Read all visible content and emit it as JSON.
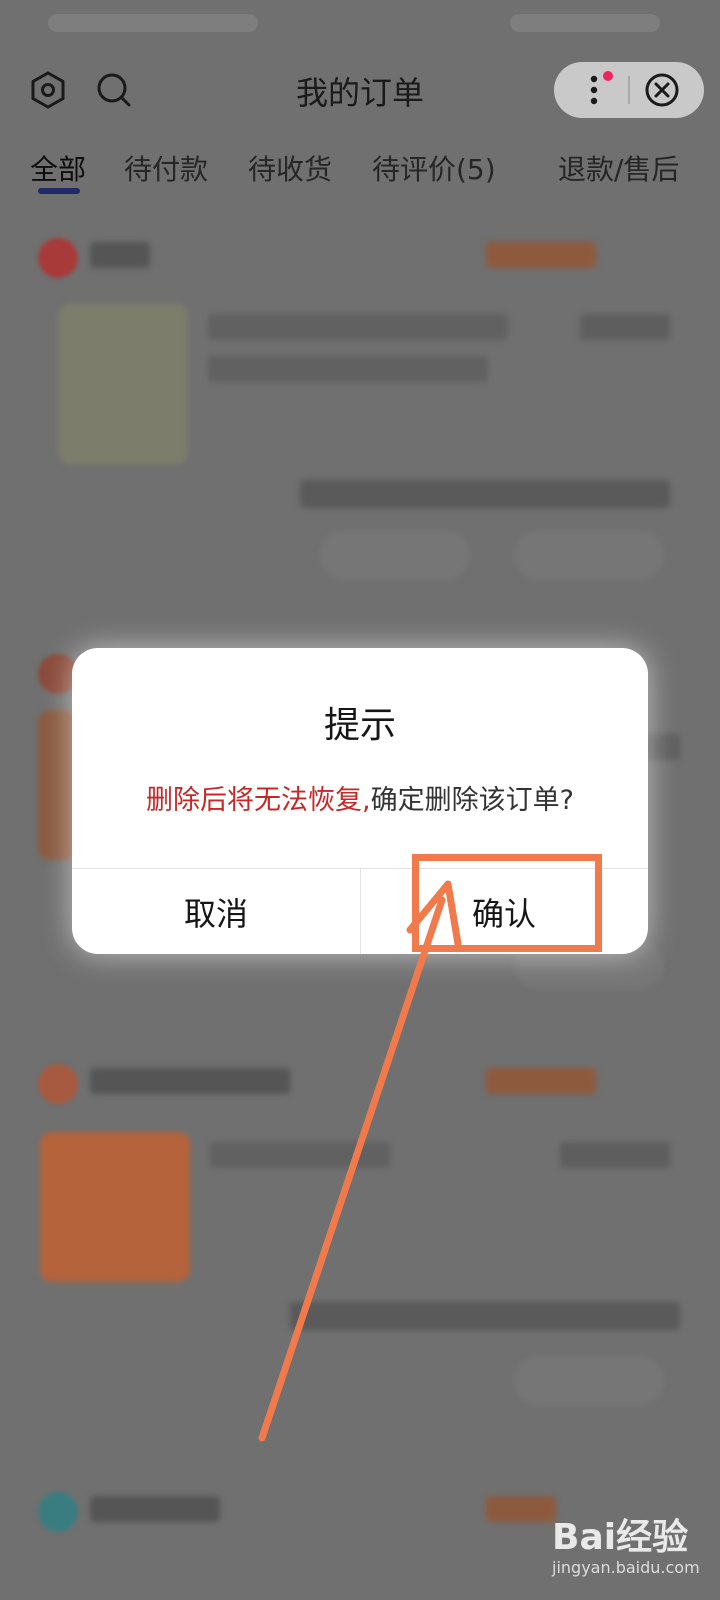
{
  "header": {
    "title": "我的订单",
    "icons": [
      "settings-icon",
      "search-icon",
      "more-icon",
      "close-icon"
    ]
  },
  "tabs": [
    {
      "label": "全部",
      "active": true
    },
    {
      "label": "待付款",
      "active": false
    },
    {
      "label": "待收货",
      "active": false
    },
    {
      "label": "待评价(5)",
      "active": false
    },
    {
      "label": "退款/售后",
      "active": false
    }
  ],
  "dialog": {
    "title": "提示",
    "message_warning": "删除后将无法恢复,",
    "message_question": "确定删除该订单?",
    "cancel_label": "取消",
    "confirm_label": "确认"
  },
  "annotation": {
    "color": "#f07a4c"
  },
  "watermark": {
    "logo": "Bai经验",
    "url": "jingyan.baidu.com"
  },
  "colors": {
    "tab_indicator": "#1f2a66",
    "warning_text": "#c62828",
    "capsule_dot": "#f0245a"
  }
}
